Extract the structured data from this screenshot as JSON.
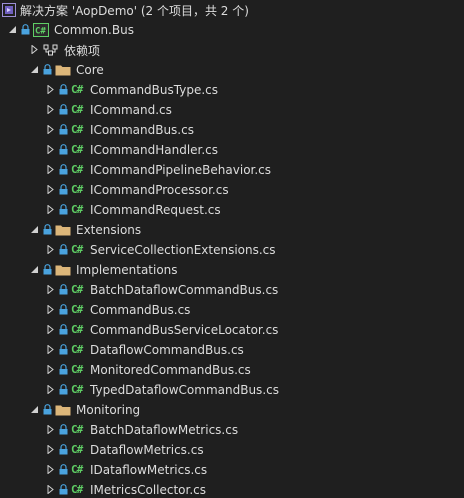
{
  "solution": {
    "label": "解决方案 'AopDemo' (2 个项目，共 2 个)"
  },
  "project": {
    "label": "Common.Bus"
  },
  "dependencies": {
    "label": "依赖项"
  },
  "folders": {
    "core": {
      "label": "Core",
      "files": [
        "CommandBusType.cs",
        "ICommand.cs",
        "ICommandBus.cs",
        "ICommandHandler.cs",
        "ICommandPipelineBehavior.cs",
        "ICommandProcessor.cs",
        "ICommandRequest.cs"
      ]
    },
    "extensions": {
      "label": "Extensions",
      "files": [
        "ServiceCollectionExtensions.cs"
      ]
    },
    "implementations": {
      "label": "Implementations",
      "files": [
        "BatchDataflowCommandBus.cs",
        "CommandBus.cs",
        "CommandBusServiceLocator.cs",
        "DataflowCommandBus.cs",
        "MonitoredCommandBus.cs",
        "TypedDataflowCommandBus.cs"
      ]
    },
    "monitoring": {
      "label": "Monitoring",
      "files": [
        "BatchDataflowMetrics.cs",
        "DataflowMetrics.cs",
        "IDataflowMetrics.cs",
        "IMetricsCollector.cs"
      ]
    }
  },
  "icons": {
    "cs_glyph": "C#",
    "csharp_color": "#5fcf65",
    "folder_color": "#dcb67a",
    "lock_color": "#4aa3df"
  }
}
